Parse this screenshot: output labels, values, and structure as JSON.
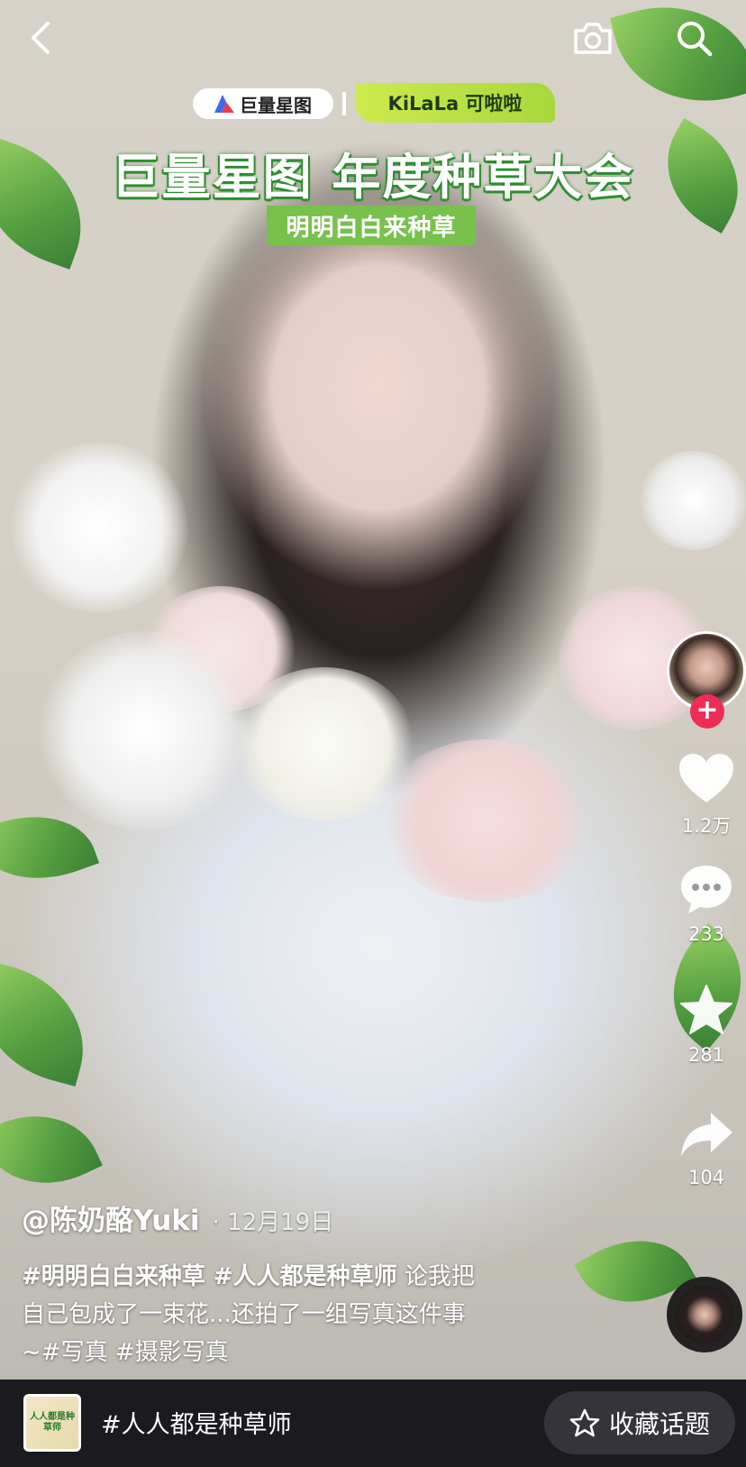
{
  "banner": {
    "brand": "巨量星图",
    "partner": "KiLaLa 可啦啦",
    "title": "巨量星图 年度种草大会",
    "subtitle": "明明白白来种草"
  },
  "rail": {
    "like_count": "1.2万",
    "comment_count": "233",
    "favorite_count": "281",
    "share_count": "104",
    "follow_symbol": "+"
  },
  "caption": {
    "author": "@陈奶酪Yuki",
    "date": "· 12月19日",
    "tags_line1": "#明明白白来种草 #人人都是种草师",
    "text_line1": " 论我把",
    "text_line2": "自己包成了一束花...还拍了一组写真这件事",
    "text_line3": "~#写真 #摄影写真"
  },
  "bottom": {
    "topic_thumb_text": "人人都是种草师",
    "topic_name": "#人人都是种草师",
    "save_label": "收藏话题"
  },
  "icons": {
    "back": "chevron-left-icon",
    "camera": "camera-icon",
    "search": "search-icon",
    "like": "heart-icon",
    "comment": "comment-icon",
    "favorite": "star-icon",
    "share": "share-arrow-icon",
    "save_topic": "star-outline-icon"
  },
  "colors": {
    "follow_red": "#ee2c55",
    "banner_green": "#79c14d",
    "bottom_bar": "#1a1a1f"
  }
}
